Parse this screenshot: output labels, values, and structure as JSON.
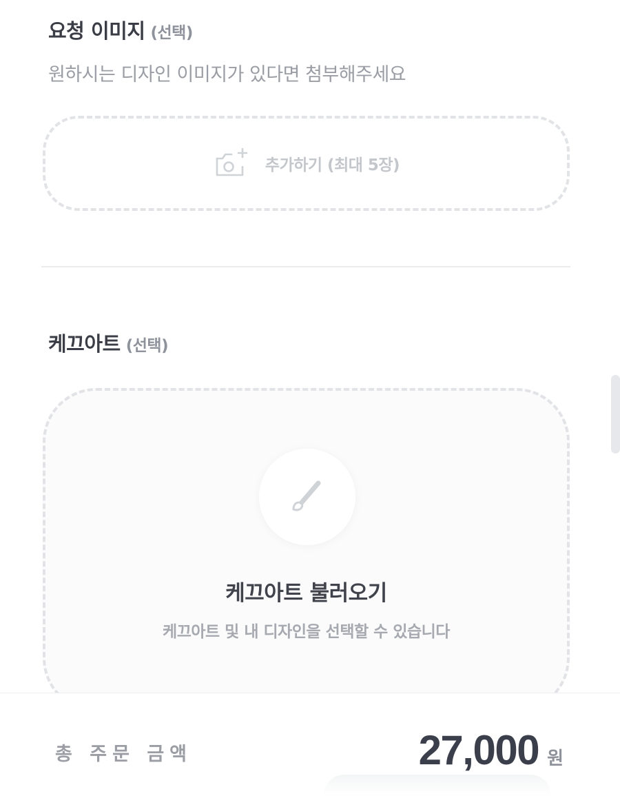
{
  "request_image": {
    "title": "요청 이미지",
    "optional": "(선택)",
    "hint": "원하시는 디자인 이미지가 있다면 첨부해주세요",
    "upload_label": "추가하기 (최대 5장)",
    "icon": "camera-add-icon"
  },
  "cake_art": {
    "title": "케끄아트",
    "optional": "(선택)",
    "load_title": "케끄아트 불러오기",
    "load_desc": "케끄아트 및 내 디자인을 선택할 수 있습니다",
    "icon": "paintbrush-icon"
  },
  "footer": {
    "total_label": "총 주문 금액",
    "total_amount": "27,000",
    "currency": "원"
  },
  "colors": {
    "title": "#3a3d45",
    "muted": "#9a9da4",
    "dashed_border": "#e1e3e6",
    "amount": "#3b3e4b"
  }
}
